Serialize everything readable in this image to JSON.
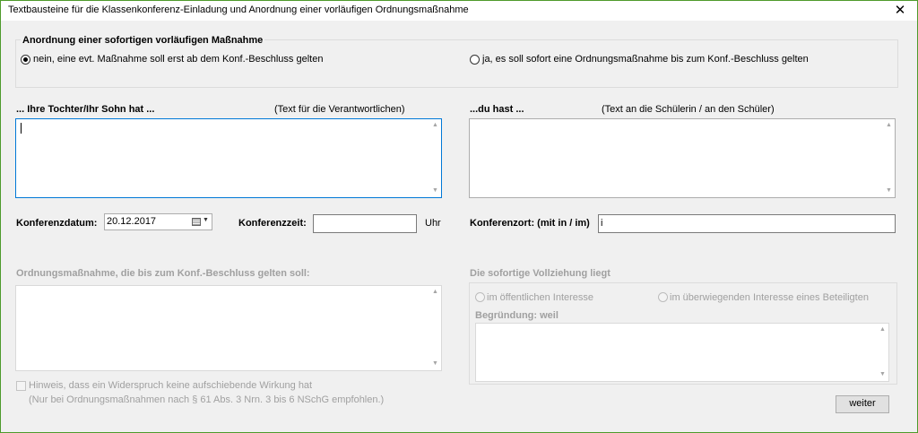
{
  "window": {
    "title": "Textbausteine für die Klassenkonferenz-Einladung und Anordnung einer vorläufigen Ordnungsmaßnahme",
    "close_glyph": "✕"
  },
  "anordnung": {
    "heading": "Anordnung einer sofortigen vorläufigen Maßnahme",
    "option_no": "nein, eine evt. Maßnahme soll erst ab dem Konf.-Beschluss gelten",
    "option_yes": "ja, es soll sofort eine Ordnungsmaßnahme bis zum Konf.-Beschluss gelten",
    "selected": "no"
  },
  "tochter": {
    "label": "... Ihre Tochter/Ihr Sohn hat ...",
    "hint": "(Text für die Verantwortlichen)",
    "value": ""
  },
  "du": {
    "label": "...du hast ...",
    "hint": "(Text an die Schülerin / an den Schüler)",
    "value": ""
  },
  "konferenz": {
    "datum_label": "Konferenzdatum:",
    "datum_value": "20.12.2017",
    "zeit_label": "Konferenzzeit:",
    "zeit_value": "",
    "zeit_unit": "Uhr",
    "ort_label": "Konferenzort: (mit in / im)",
    "ort_value": "i"
  },
  "ordnungsmassnahme": {
    "label": "Ordnungsmaßnahme, die bis zum Konf.-Beschluss gelten soll:",
    "value": ""
  },
  "vollziehung": {
    "label": "Die sofortige Vollziehung liegt",
    "option_public": "im öffentlichen Interesse",
    "option_private": "im überwiegenden Interesse eines Beteiligten",
    "begruendung_label": "Begründung: weil",
    "begruendung_value": ""
  },
  "hinweis": {
    "label": "Hinweis, dass ein Widerspruch keine aufschiebende Wirkung hat",
    "note": "(Nur bei Ordnungsmaßnahmen nach § 61 Abs. 3 Nrn. 3 bis 6 NSchG empfohlen.)"
  },
  "buttons": {
    "weiter": "weiter"
  },
  "icons": {
    "scroll_up": "▲",
    "scroll_down": "▼",
    "dropdown": "▼"
  }
}
